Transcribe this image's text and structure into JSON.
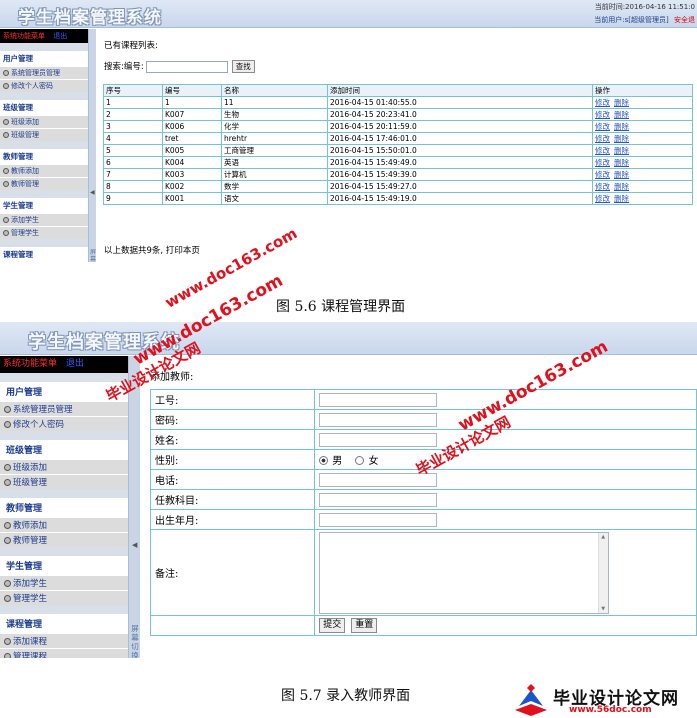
{
  "header": {
    "app_title": "学生档案管理系统",
    "time": "当前时间:2016-04-16 11:51:0",
    "user": "当前用户:s[超级管理员]",
    "logout": "安全退"
  },
  "sidebar": {
    "menu_title": "系统功能菜单",
    "menu_tab": "退出",
    "groups": [
      {
        "title": "用户管理",
        "items": [
          "系统管理员管理",
          "修改个人密码"
        ]
      },
      {
        "title": "班级管理",
        "items": [
          "班级添加",
          "班级管理"
        ]
      },
      {
        "title": "教师管理",
        "items": [
          "教师添加",
          "教师管理"
        ]
      },
      {
        "title": "学生管理",
        "items": [
          "添加学生",
          "管理学生"
        ]
      },
      {
        "title": "课程管理",
        "items": [
          "添加课程",
          "管理课程"
        ]
      }
    ],
    "splitter_text": "屏幕切换"
  },
  "course_page": {
    "title": "已有课程列表:",
    "search_label": "搜索:编号:",
    "search_value": "",
    "search_button": "查找",
    "columns": [
      "序号",
      "编号",
      "名称",
      "添加时间",
      "操作"
    ],
    "rows": [
      {
        "no": "1",
        "code": "1",
        "name": "11",
        "time": "2016-04-15 01:40:55.0"
      },
      {
        "no": "2",
        "code": "K007",
        "name": "生物",
        "time": "2016-04-15 20:23:41.0"
      },
      {
        "no": "3",
        "code": "K006",
        "name": "化学",
        "time": "2016-04-15 20:11:59.0"
      },
      {
        "no": "4",
        "code": "tret",
        "name": "hrehtr",
        "time": "2016-04-15 17:46:01.0"
      },
      {
        "no": "5",
        "code": "K005",
        "name": "工商管理",
        "time": "2016-04-15 15:50:01.0"
      },
      {
        "no": "6",
        "code": "K004",
        "name": "英语",
        "time": "2016-04-15 15:49:49.0"
      },
      {
        "no": "7",
        "code": "K003",
        "name": "计算机",
        "time": "2016-04-15 15:49:39.0"
      },
      {
        "no": "8",
        "code": "K002",
        "name": "数学",
        "time": "2016-04-15 15:49:27.0"
      },
      {
        "no": "9",
        "code": "K001",
        "name": "语文",
        "time": "2016-04-15 15:49:19.0"
      }
    ],
    "edit_label": "修改",
    "delete_label": "删除",
    "footer": "以上数据共9条, 打印本页"
  },
  "caption1": "图 5.6 课程管理界面",
  "teacher_page": {
    "title": "添加教师:",
    "fields": {
      "id": "工号:",
      "password": "密码:",
      "name": "姓名:",
      "gender": "性别:",
      "phone": "电话:",
      "subject": "任教科目:",
      "birth": "出生年月:",
      "remark": "备注:"
    },
    "gender_male": "男",
    "gender_female": "女",
    "submit": "提交",
    "reset": "重置"
  },
  "caption2": "图 5.7 录入教师界面",
  "watermarks": {
    "site_name": "毕业设计论文网",
    "site_url": "www.doc163.com",
    "logo_url": "www.56doc.com"
  }
}
